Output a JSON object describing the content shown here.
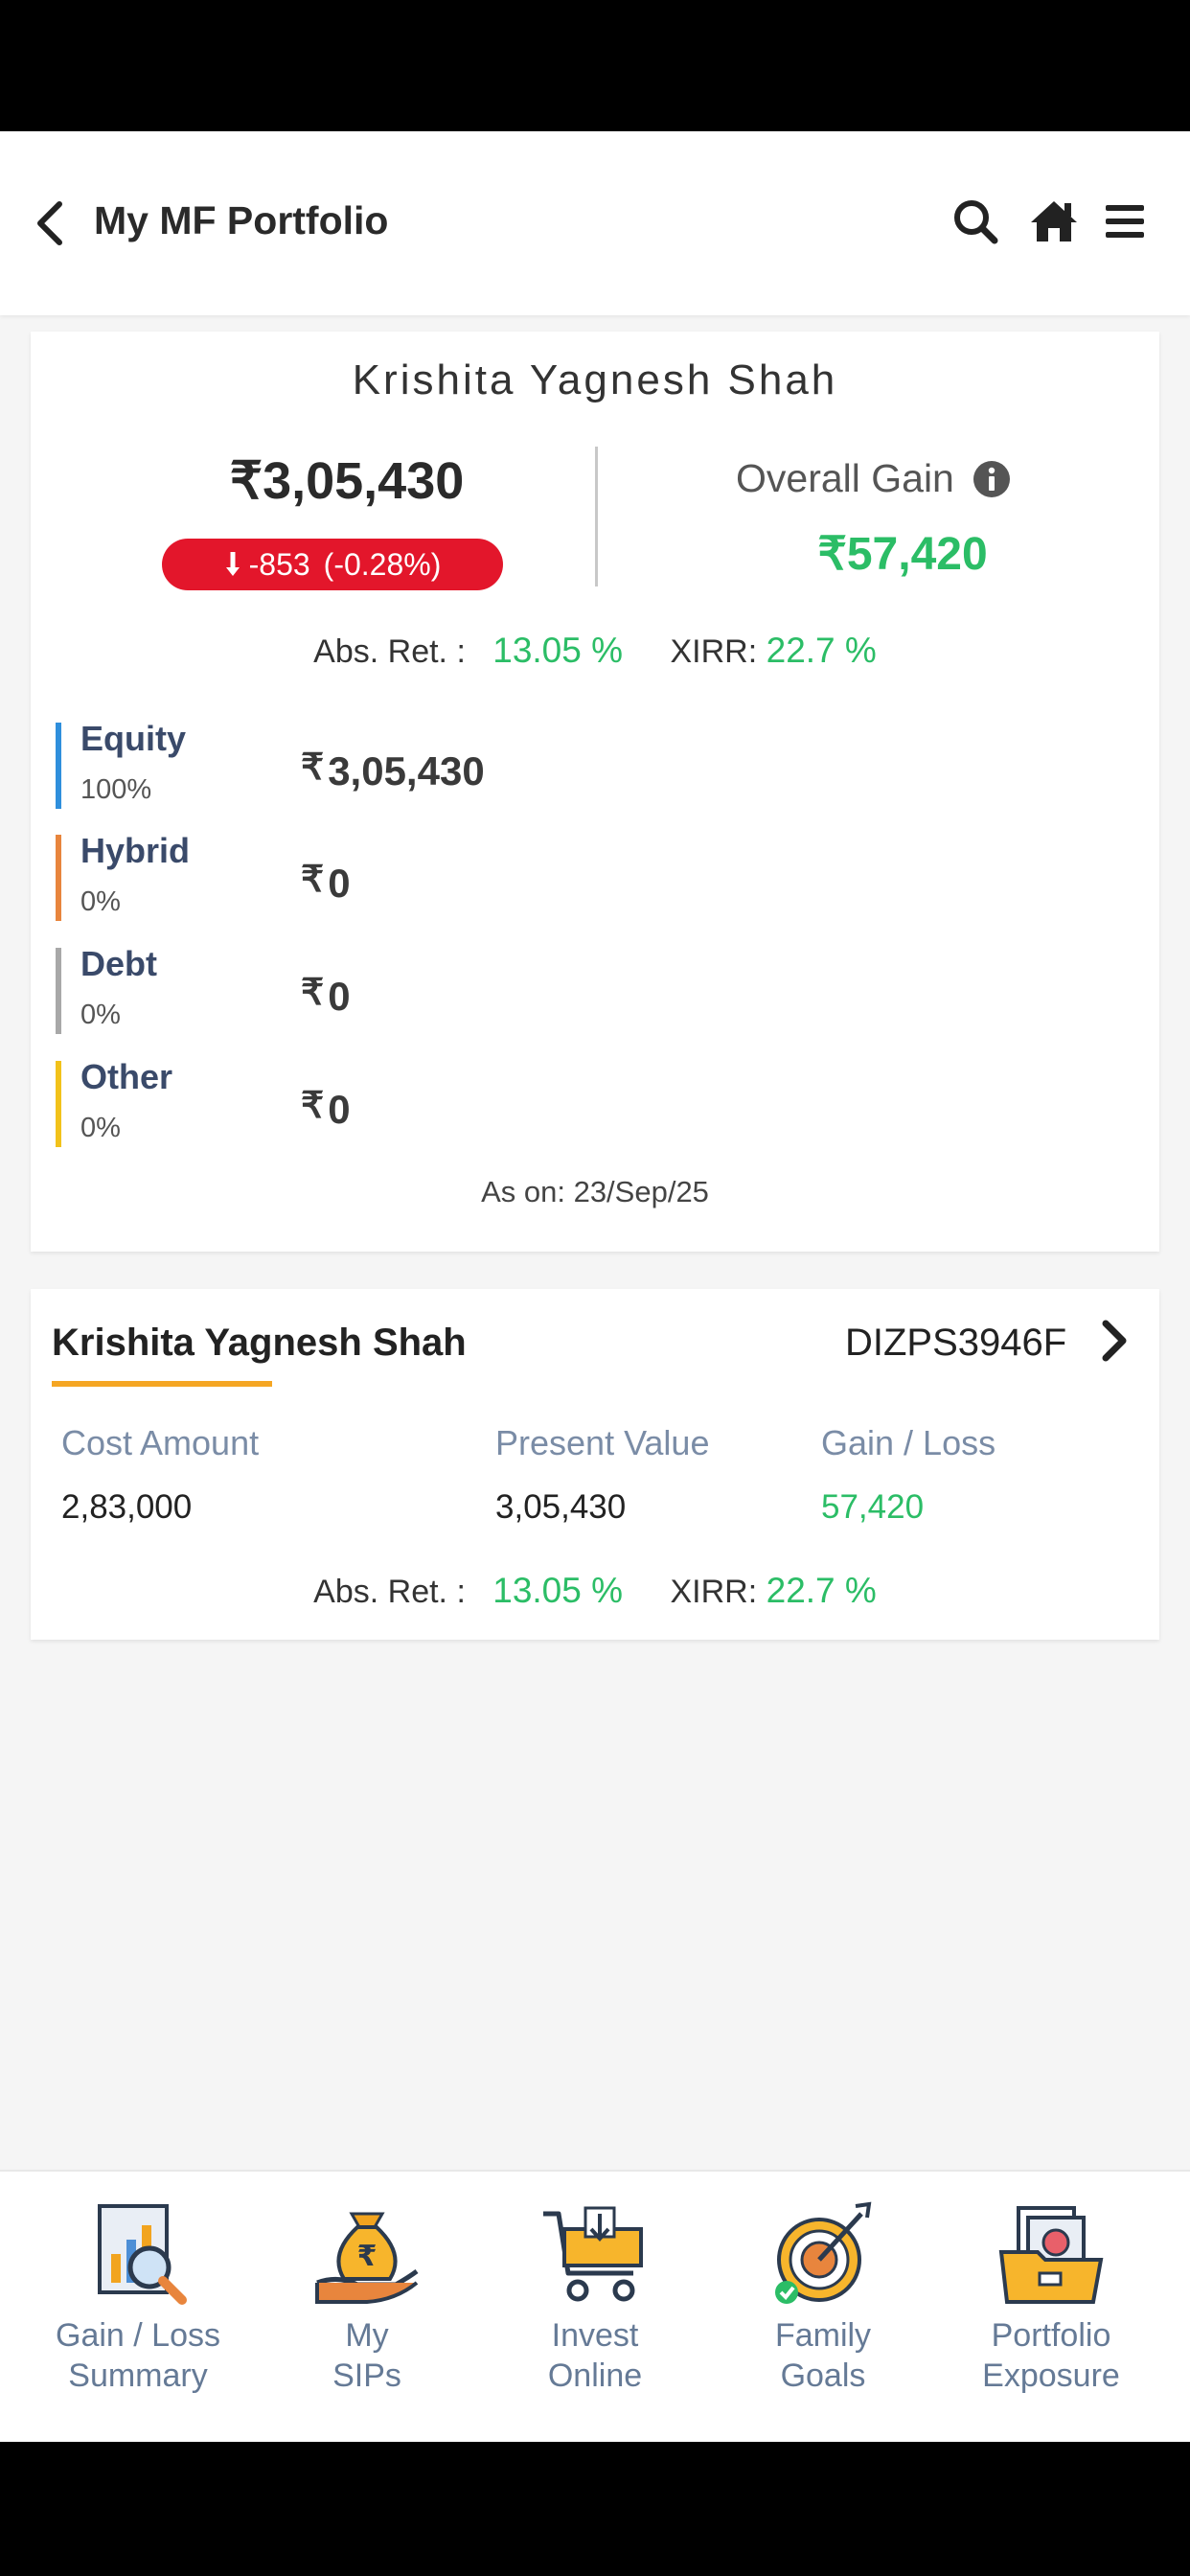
{
  "header": {
    "title": "My MF Portfolio"
  },
  "summary": {
    "name": "Krishita Yagnesh Shah",
    "total_value": "₹3,05,430",
    "day_change": "-853",
    "day_change_pct": "(-0.28%)",
    "overall_gain_label": "Overall Gain",
    "overall_gain_value": "₹57,420",
    "abs_ret_label": "Abs. Ret. :",
    "abs_ret_value": "13.05 %",
    "xirr_label": "XIRR:",
    "xirr_value": "22.7 %",
    "allocations": [
      {
        "name": "Equity",
        "pct": "100%",
        "value": "3,05,430",
        "color": "#2f8fdc"
      },
      {
        "name": "Hybrid",
        "pct": "0%",
        "value": "0",
        "color": "#e8853d"
      },
      {
        "name": "Debt",
        "pct": "0%",
        "value": "0",
        "color": "#a8a8a8"
      },
      {
        "name": "Other",
        "pct": "0%",
        "value": "0",
        "color": "#f2c21b"
      }
    ],
    "rupee_symbol": "₹",
    "as_on": "As on:  23/Sep/25"
  },
  "holder": {
    "name": "Krishita Yagnesh Shah",
    "pan": "DIZPS3946F",
    "cost_label": "Cost Amount",
    "present_label": "Present Value",
    "gain_label": "Gain / Loss",
    "cost_value": "2,83,000",
    "present_value": "3,05,430",
    "gain_value": "57,420",
    "abs_ret_label": "Abs. Ret. :",
    "abs_ret_value": "13.05 %",
    "xirr_label": "XIRR:",
    "xirr_value": "22.7 %"
  },
  "bottom_nav": [
    {
      "line1": "Gain / Loss",
      "line2": "Summary",
      "icon": "report-magnifier-icon"
    },
    {
      "line1": "My",
      "line2": "SIPs",
      "icon": "money-bag-hand-icon"
    },
    {
      "line1": "Invest",
      "line2": "Online",
      "icon": "shopping-cart-icon"
    },
    {
      "line1": "Family",
      "line2": "Goals",
      "icon": "target-goal-icon"
    },
    {
      "line1": "Portfolio",
      "line2": "Exposure",
      "icon": "folder-documents-icon"
    }
  ],
  "colors": {
    "green": "#2bbd66",
    "red_pill": "#e3162b",
    "orange_accent": "#f5a623"
  }
}
